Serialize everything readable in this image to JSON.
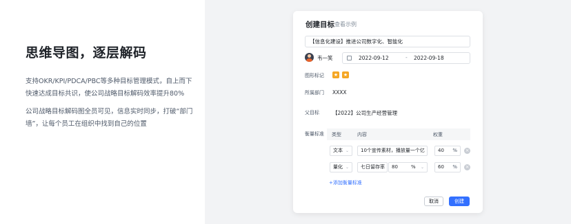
{
  "left": {
    "headline": "思维导图，逐层解码",
    "paragraph1": "支持OKR/KPI/PDCA/PBC等多种目标管理模式，自上而下快速达成目标共识，使公司战略目标解码效率提升80%",
    "paragraph2": "公司战略目标解码图全员可见，信息实时同步，打破“部门墙”，让每个员工在组织中找到自己的位置"
  },
  "modal": {
    "title": "创建目标",
    "example_link": "查看示例",
    "goal_name": "【信息化建设】推进公司数字化、智能化",
    "owner": "韦一笑",
    "start_date": "2022-09-12",
    "date_separator": "-",
    "end_date": "2022-09-18",
    "graphic_tag_label": "图形标记",
    "department_label": "所属部门",
    "department_value": "XXXX",
    "parent_goal_label": "父目标",
    "parent_goal_value": "【2022】公司生产经营管理",
    "measure_label": "衡量标准",
    "table": {
      "col_type": "类型",
      "col_content": "内容",
      "col_weight": "权重",
      "rows": [
        {
          "type": "文本",
          "content": "10个宣传素材，播放量一个亿",
          "weight": "40",
          "unit": "%"
        },
        {
          "type": "量化",
          "content": "七日留存率",
          "value": "80",
          "value_unit": "%",
          "weight": "60",
          "unit": "%"
        }
      ]
    },
    "add_measure": "+添加衡量标准",
    "cancel_button": "取消",
    "create_button": "创建"
  },
  "icons": {
    "calendar": "calendar-icon",
    "avatar": "user-avatar",
    "star": "star-icon",
    "remove": "remove-circle-icon",
    "caret": "chevron-down-icon"
  },
  "colors": {
    "accent": "#3370ff",
    "star": "#f5a623",
    "stage_bg": "#f2f3f5"
  }
}
